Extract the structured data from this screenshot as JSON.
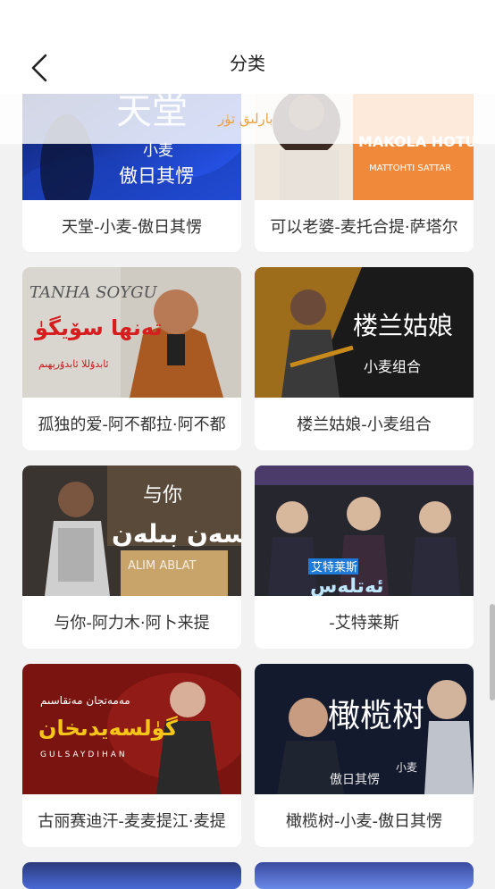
{
  "header": {
    "title": "分类",
    "back_icon": "chevron-left-icon"
  },
  "tabs": {
    "active": "بارلىق تۈر"
  },
  "songs": [
    {
      "caption": "天堂-小麦-傲日其愣",
      "art": {
        "line1": "天堂",
        "line2": "小麦",
        "line3": "傲日其愣"
      }
    },
    {
      "caption": "可以老婆-麦托合提·萨塔尔",
      "art": {
        "line1": "MAKOLA HOTUN",
        "line2": "MATTOHTI SATTAR"
      }
    },
    {
      "caption": "孤独的爱-阿不都拉·阿不都",
      "art": {
        "line1": "TANHA SOYGU",
        "line2": "تەنھا سۆيگۈ",
        "line3": "ئابدۇللا ئابدۇرېھىم"
      }
    },
    {
      "caption": "楼兰姑娘-小麦组合",
      "art": {
        "line1": "楼兰姑娘",
        "line2": "小麦组合"
      }
    },
    {
      "caption": "与你-阿力木·阿卜来提",
      "art": {
        "line1": "与你",
        "line2": "سەن بىلەن",
        "line3": "ALIM ABLAT"
      }
    },
    {
      "caption": "-艾特莱斯",
      "art": {
        "line1": "艾特莱斯",
        "line2": "ئەتلەس"
      }
    },
    {
      "caption": "古丽赛迪汗-麦麦提江·麦提",
      "art": {
        "line1": "مەمەتجان مەتقاسىم",
        "line2": "گۈلسەيدىخان",
        "line3": "GULSAYDIHAN"
      }
    },
    {
      "caption": "橄榄树-小麦-傲日其愣",
      "art": {
        "line1": "橄榄树",
        "line2": "傲日其愣",
        "line3": "小麦"
      }
    }
  ]
}
